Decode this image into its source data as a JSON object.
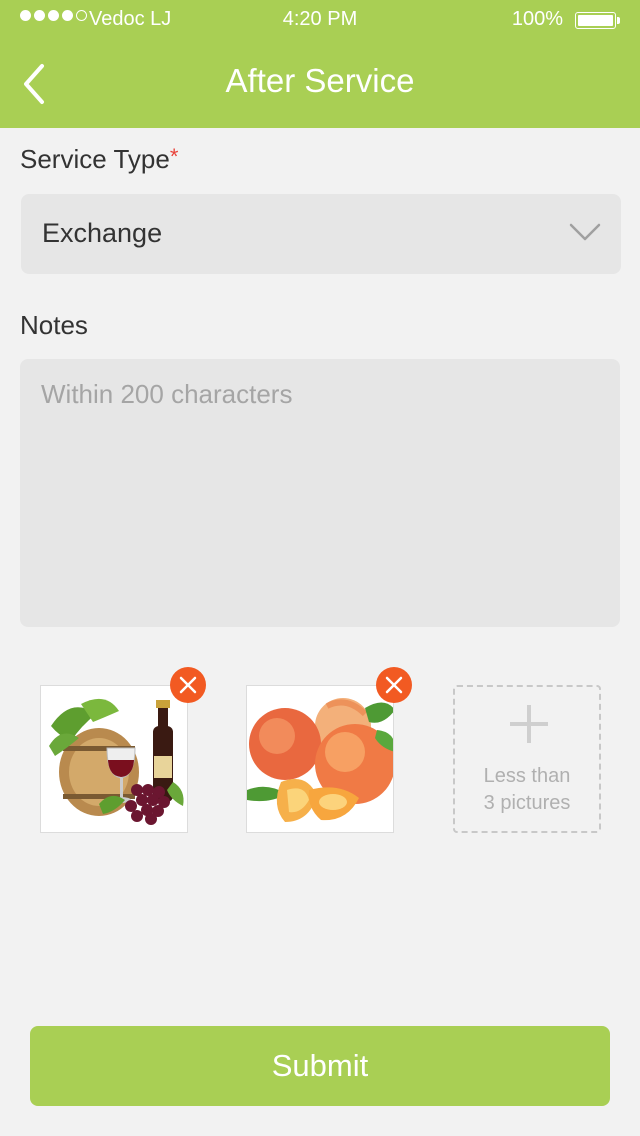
{
  "status_bar": {
    "carrier": "Vedoc LJ",
    "time": "4:20 PM",
    "battery": "100%"
  },
  "header": {
    "title": "After Service"
  },
  "form": {
    "service_type_label": "Service Type",
    "required_mark": "*",
    "service_type_value": "Exchange",
    "notes_label": "Notes",
    "notes_placeholder": "Within 200 characters",
    "notes_value": ""
  },
  "pictures": {
    "items": [
      {
        "subject": "wine barrel, wine bottle, glass and grapes"
      },
      {
        "subject": "peaches"
      }
    ],
    "add_hint_line1": "Less than",
    "add_hint_line2": "3 pictures"
  },
  "submit_label": "Submit",
  "colors": {
    "accent": "#a9cf54",
    "remove": "#f25a22",
    "required": "#e8433b"
  }
}
